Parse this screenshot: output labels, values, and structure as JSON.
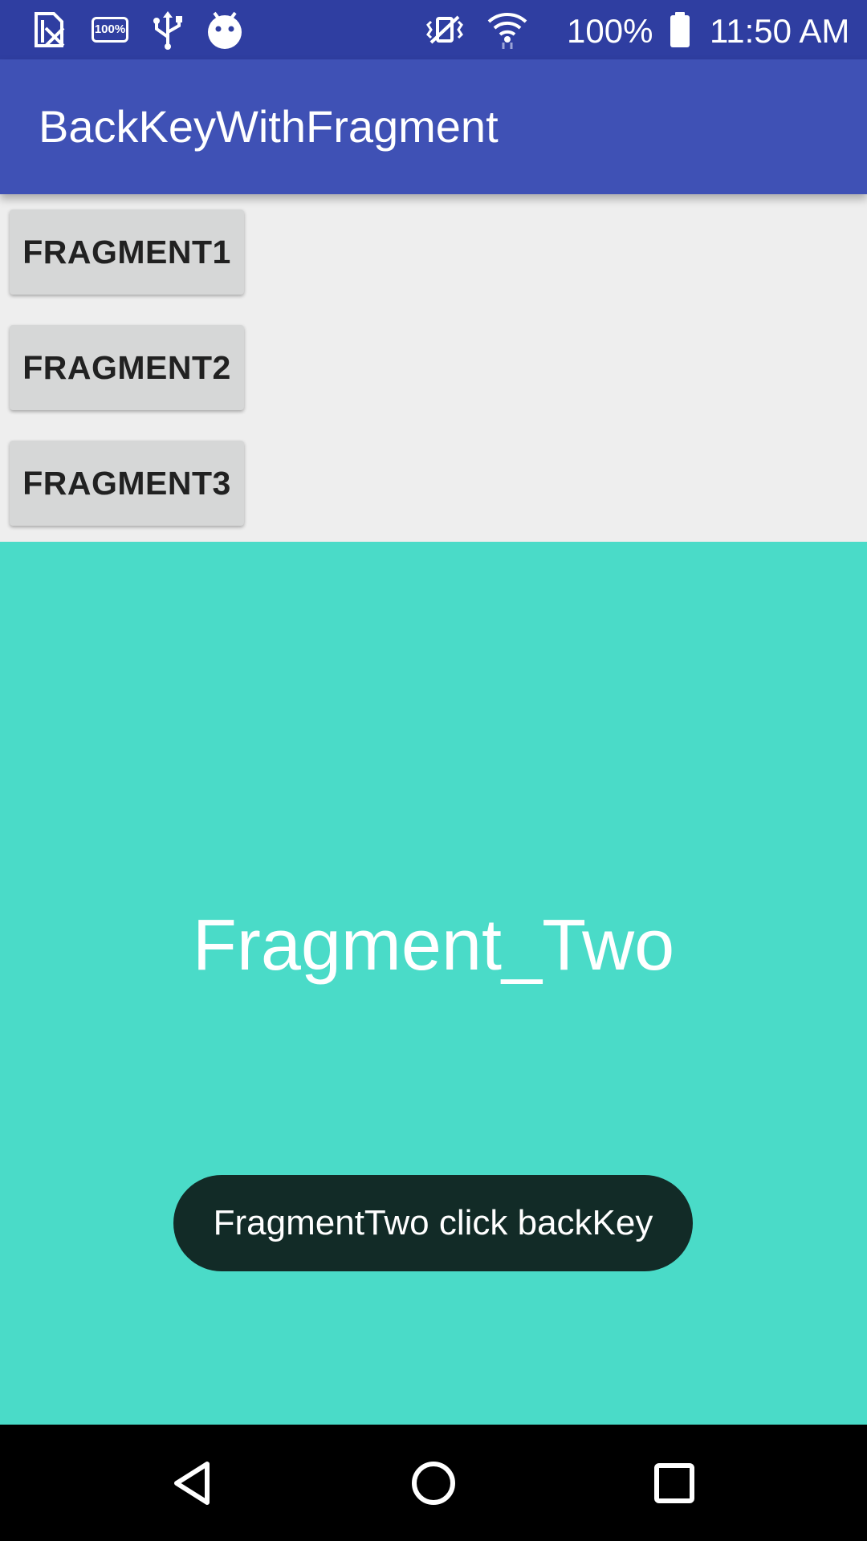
{
  "status_bar": {
    "icons": [
      "sim-card-off-icon",
      "battery-full-badge-icon",
      "usb-icon",
      "android-debug-icon",
      "vibrate-icon",
      "wifi-icon",
      "battery-icon"
    ],
    "battery_badge_text": "100%",
    "battery_percent": "100%",
    "time": "11:50 AM"
  },
  "app_bar": {
    "title": "BackKeyWithFragment"
  },
  "buttons": [
    {
      "label": "FRAGMENT1"
    },
    {
      "label": "FRAGMENT2"
    },
    {
      "label": "FRAGMENT3"
    }
  ],
  "fragment": {
    "label": "Fragment_Two",
    "background_color": "#4ADBC8"
  },
  "toast": {
    "message": "FragmentTwo click backKey"
  },
  "nav_bar": {
    "icons": [
      "back-icon",
      "home-icon",
      "recents-icon"
    ]
  },
  "colors": {
    "status_bar": "#2F3EA1",
    "app_bar": "#3F51B5",
    "button_area": "#EEEEEE",
    "button": "#D6D7D7",
    "toast": "#122B27",
    "nav_bar": "#000000"
  }
}
